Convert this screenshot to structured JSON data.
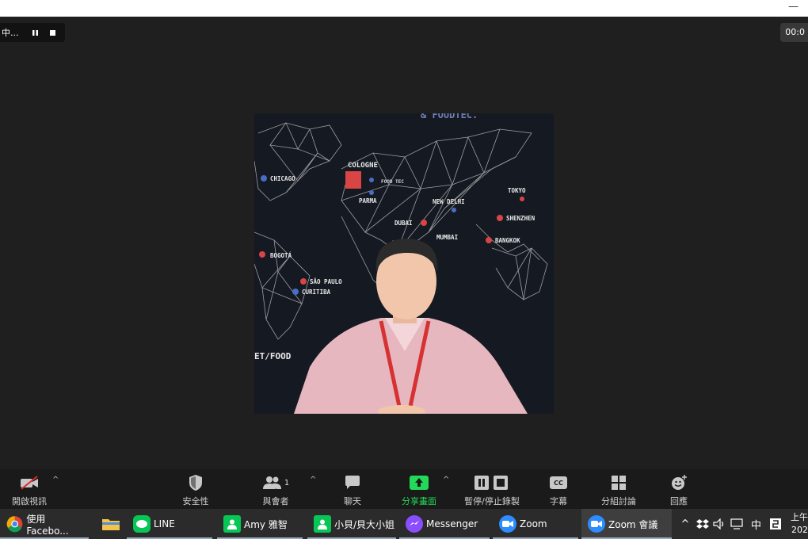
{
  "window": {
    "minimize_glyph": "—"
  },
  "recording": {
    "status_text": "中...",
    "timer": "00:0"
  },
  "map": {
    "top_text": "& FOODTEC.",
    "bottom_text": "ET/FOOD",
    "cities": [
      "CHICAGO",
      "COLOGNE",
      "PARMA",
      "NEW DELHI",
      "TOKYO",
      "SHENZHEN",
      "DUBAI",
      "MUMBAI",
      "BANGKOK",
      "BOGOTÁ",
      "SÃO PAULO",
      "CURITIBA"
    ],
    "logo_text": "FOOD TEC"
  },
  "toolbar": {
    "video_label": "開啟視訊",
    "security_label": "安全性",
    "participants_label": "與會者",
    "participants_count": "1",
    "chat_label": "聊天",
    "share_label": "分享畫面",
    "record_label": "暫停/停止錄製",
    "cc_label": "字幕",
    "cc_icon_text": "CC",
    "breakout_label": "分組討論",
    "reactions_label": "回應"
  },
  "taskbar": {
    "apps": [
      {
        "label": "使用 Facebo..."
      },
      {
        "label": ""
      },
      {
        "label": "LINE"
      },
      {
        "label": "Amy 雅智"
      },
      {
        "label": "小貝/貝大小姐"
      },
      {
        "label": "Messenger"
      },
      {
        "label": "Zoom"
      },
      {
        "label": "Zoom 會議"
      }
    ],
    "ime": "中",
    "clock_line1": "上午",
    "clock_line2": "202"
  },
  "colors": {
    "share_green": "#23d959",
    "line_green": "#06c755",
    "zoom_blue": "#2d8cff",
    "muted_red": "#e02828"
  }
}
